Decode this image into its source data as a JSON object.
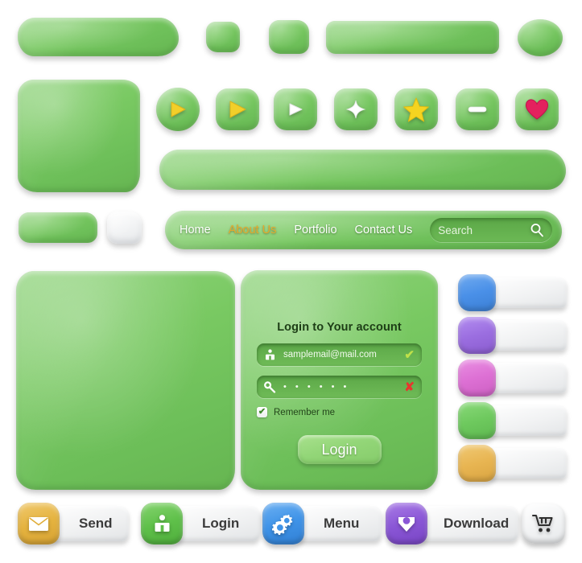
{
  "kit": {
    "style": "plasticine-clay-ui-kit",
    "base_green": "#77cc66",
    "accent_gold": "#e3aa2d"
  },
  "shapes_row1": [
    {
      "name": "large-rounded-bar",
      "color": "#77cc66"
    },
    {
      "name": "small-square",
      "color": "#77cc66"
    },
    {
      "name": "medium-square",
      "color": "#77cc66"
    },
    {
      "name": "wide-bar",
      "color": "#77cc66"
    },
    {
      "name": "ellipse",
      "color": "#77cc66"
    }
  ],
  "icon_buttons": [
    {
      "icon": "play-icon",
      "shape": "circle",
      "color": "#f2cf2a"
    },
    {
      "icon": "play-icon",
      "shape": "square",
      "color": "#f2cf2a"
    },
    {
      "icon": "play-icon",
      "shape": "square",
      "color": "#ffffff"
    },
    {
      "icon": "plus-icon",
      "shape": "square",
      "color": "#ffffff"
    },
    {
      "icon": "star-icon",
      "shape": "square",
      "color": "#f5d420"
    },
    {
      "icon": "minus-icon",
      "shape": "square",
      "color": "#ffffff"
    },
    {
      "icon": "heart-icon",
      "shape": "square",
      "color": "#e4215e"
    }
  ],
  "navbar": {
    "items": [
      {
        "label": "Home",
        "active": false
      },
      {
        "label": "About Us",
        "active": true
      },
      {
        "label": "Portfolio",
        "active": false
      },
      {
        "label": "Contact Us",
        "active": false
      }
    ],
    "search": {
      "placeholder": "Search",
      "value": "Search",
      "icon": "search-icon"
    }
  },
  "login_card": {
    "title": "Login to Your account",
    "email_field": {
      "icon": "user-icon",
      "value": "samplemail@mail.com",
      "status": "✔",
      "status_state": "valid"
    },
    "password_field": {
      "icon": "key-icon",
      "value": "• • • • • •",
      "status": "✘",
      "status_state": "invalid"
    },
    "remember": {
      "label": "Remember me",
      "checked": true,
      "check_glyph": "✔"
    },
    "submit_label": "Login"
  },
  "swatches": [
    {
      "name": "blue",
      "color": "#4a90e8"
    },
    {
      "name": "purple",
      "color": "#9b6ee0"
    },
    {
      "name": "magenta",
      "color": "#dd70d4"
    },
    {
      "name": "green",
      "color": "#6ec95e"
    },
    {
      "name": "gold",
      "color": "#e8b552"
    }
  ],
  "action_buttons": [
    {
      "label": "Send",
      "icon": "envelope-icon",
      "icon_color": "#e5b33f",
      "has_label": true
    },
    {
      "label": "Login",
      "icon": "user-icon",
      "icon_color": "#5fc04a",
      "has_label": true
    },
    {
      "label": "Menu",
      "icon": "gears-icon",
      "icon_color": "#3f93e8",
      "has_label": true
    },
    {
      "label": "Download",
      "icon": "download-icon",
      "icon_color": "#8a56d6",
      "has_label": true
    },
    {
      "label": "",
      "icon": "cart-icon",
      "icon_color": "#f2f3f4",
      "has_label": false
    }
  ]
}
